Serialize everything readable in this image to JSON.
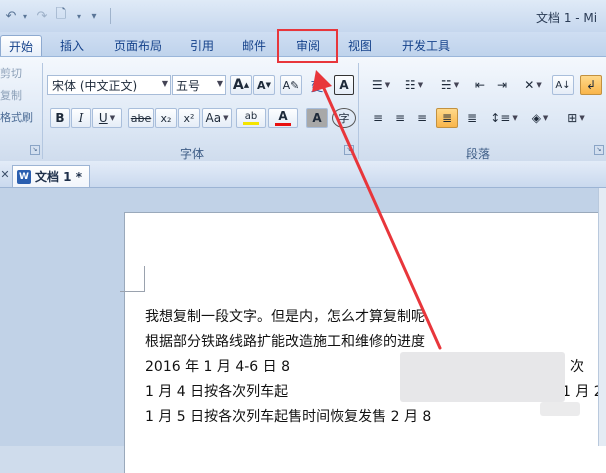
{
  "title_bar": {
    "title": "文档 1 - Mi",
    "qat": [
      {
        "icon": "undo-icon",
        "glyph": "↶"
      },
      {
        "icon": "redo-icon",
        "glyph": "↷"
      },
      {
        "icon": "print-preview-icon",
        "glyph": "🗋"
      },
      {
        "icon": "customize-qat-icon",
        "glyph": "▾"
      }
    ]
  },
  "tabs": [
    {
      "label": "开始",
      "active": true
    },
    {
      "label": "插入"
    },
    {
      "label": "页面布局"
    },
    {
      "label": "引用"
    },
    {
      "label": "邮件"
    },
    {
      "label": "审阅",
      "highlighted": true
    },
    {
      "label": "视图"
    },
    {
      "label": "开发工具"
    }
  ],
  "clipboard": {
    "cut": "剪切",
    "copy": "复制",
    "format_painter": "格式刷"
  },
  "font_group": {
    "label": "字体",
    "font_name": "宋体 (中文正文)",
    "font_size": "五号",
    "grow_font": "A",
    "shrink_font": "A",
    "phonetic": "变",
    "char_border": "A",
    "bold": "B",
    "italic": "I",
    "underline": "U",
    "strikethrough": "abe",
    "subscript": "x₂",
    "superscript": "x²",
    "change_case": "Aa",
    "highlight": "ab",
    "font_color": "A",
    "char_shading": "A",
    "enclose": "字"
  },
  "paragraph_group": {
    "label": "段落"
  },
  "document_tab": {
    "label": "文档 1 *"
  },
  "document": {
    "lines": [
      "我想复制一段文字。但是内，怎么才算复制呢",
      "根据部分铁路线路扩能改造施工和维修的进度",
      "2016 年 1 月 4-6 日 8",
      "1 月 4 日按各次列车起",
      "1 月 5 日按各次列车起售时间恢复发售 2 月 8"
    ],
    "line3_tail": "次",
    "line4_tail": "1 月 2"
  },
  "colors": {
    "annotation_red": "#e8363b",
    "ribbon_blue": "#15428b",
    "font_color_bar": "#e81010",
    "highlight_bar": "#f4e400"
  }
}
